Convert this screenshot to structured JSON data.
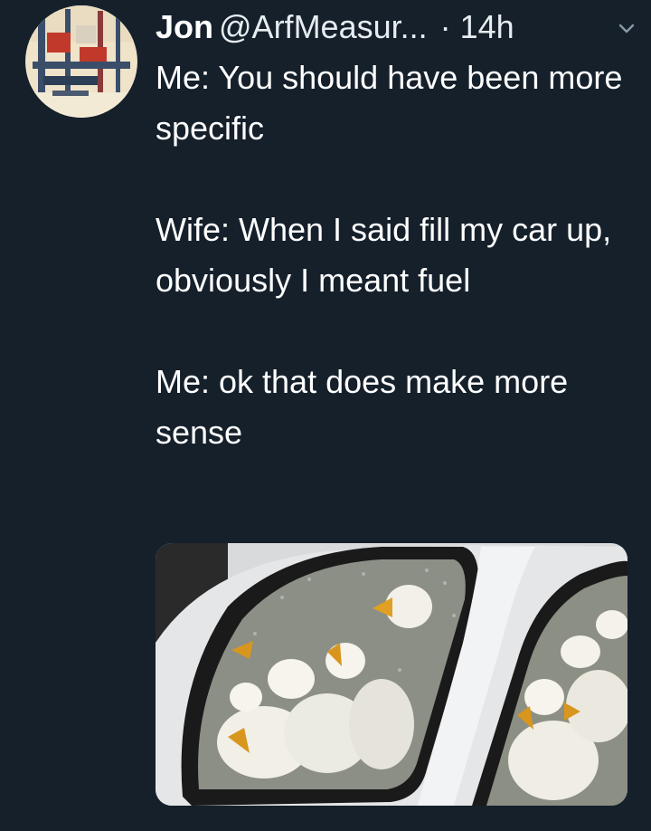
{
  "tweet": {
    "author_name": "Jon",
    "author_handle": "@ArfMeasur...",
    "timestamp": "· 14h",
    "menu_icon": "chevron-down-icon",
    "paragraphs": [
      "Me: You should have been more specific",
      "Wife: When I said fill my car up, obviously I meant fuel",
      "Me: ok that does make more sense"
    ]
  },
  "colors": {
    "background": "#15202b",
    "text": "#ffffff",
    "secondary_text": "#e6ecf0"
  }
}
